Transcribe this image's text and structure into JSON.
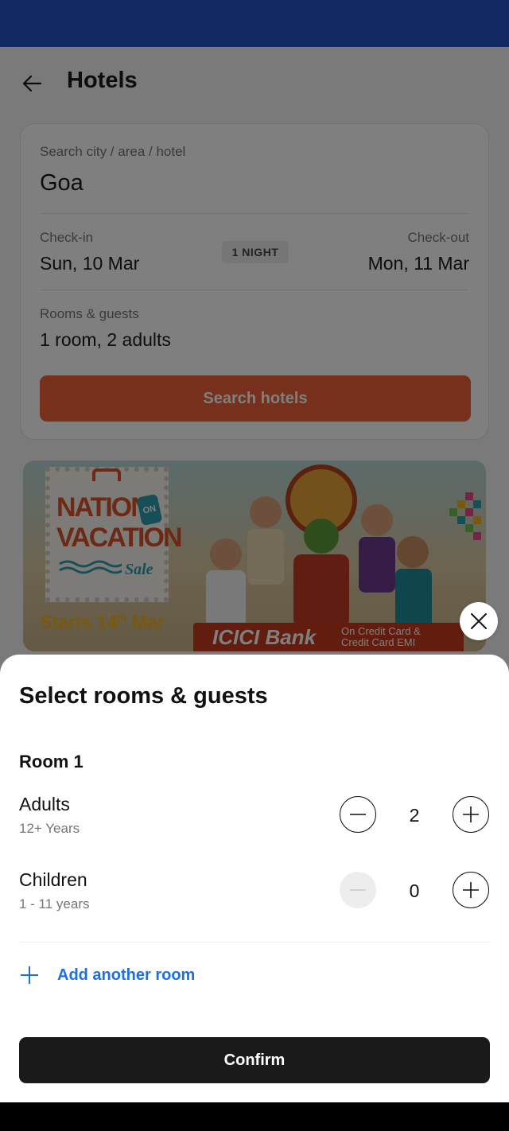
{
  "header": {
    "title": "Hotels"
  },
  "search": {
    "destination_label": "Search city / area / hotel",
    "destination_value": "Goa",
    "checkin_label": "Check-in",
    "checkin_value": "Sun, 10 Mar",
    "nights_badge": "1 NIGHT",
    "checkout_label": "Check-out",
    "checkout_value": "Mon, 11 Mar",
    "rooms_label": "Rooms & guests",
    "rooms_value": "1 room, 2 adults",
    "search_button": "Search hotels"
  },
  "banner": {
    "stamp_line1": "NATION",
    "stamp_on": "ON",
    "stamp_line2": "VACATION",
    "stamp_sale": "Sale",
    "starts_prefix": "Starts 14",
    "starts_sup": "th",
    "starts_suffix": " Mar",
    "bank_name": "ICICI Bank",
    "bank_sub_line1": "On Credit Card &",
    "bank_sub_line2": "Credit Card EMI"
  },
  "sheet": {
    "title": "Select rooms & guests",
    "room_title": "Room 1",
    "adults_label": "Adults",
    "adults_sub": "12+ Years",
    "adults_count": "2",
    "children_label": "Children",
    "children_sub": "1 - 11 years",
    "children_count": "0",
    "add_room": "Add another room",
    "confirm": "Confirm"
  },
  "colors": {
    "status_bar": "#2355c9",
    "search_button": "#ec6136",
    "link_blue": "#1e6fe0",
    "confirm_button": "#1a1a1a"
  },
  "icons": [
    "back-arrow-icon",
    "close-icon",
    "minus-icon",
    "plus-icon"
  ]
}
